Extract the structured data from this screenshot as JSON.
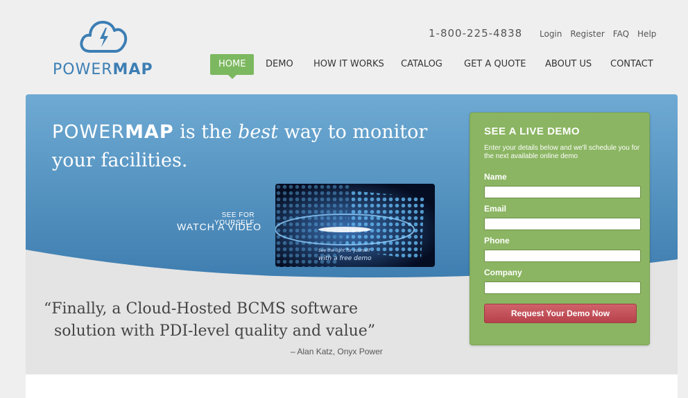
{
  "brand": {
    "logo_prefix": "POWER",
    "logo_suffix": "MAP"
  },
  "header": {
    "phone": "1-800-225-4838",
    "util_links": [
      "Login",
      "Register",
      "FAQ",
      "Help"
    ]
  },
  "nav": {
    "items": [
      "HOME",
      "DEMO",
      "HOW IT WORKS",
      "CATALOG",
      "GET A QUOTE",
      "ABOUT US",
      "CONTACT"
    ],
    "active": "HOME"
  },
  "hero": {
    "title_brand_prefix": "POWER",
    "title_brand_suffix": "MAP",
    "title_part1": " is the ",
    "title_emphasis": "best",
    "title_part2": " way to monitor your facilities.",
    "see_label": "SEE FOR YOURSELF",
    "watch_label": "WATCH A VIDEO",
    "video_caption_1": "See the light for yourself",
    "video_caption_2": "with a free demo"
  },
  "testimonial": {
    "line1": "“Finally, a Cloud-Hosted BCMS software",
    "line2": "solution with PDI-level quality and value”",
    "attribution": "– Alan Katz, Onyx Power"
  },
  "demo_form": {
    "title": "SEE A LIVE DEMO",
    "subtitle": "Enter your details below and we'll schedule you for the next available online demo",
    "fields": [
      "Name",
      "Email",
      "Phone",
      "Company"
    ],
    "submit_label": "Request Your Demo Now"
  },
  "colors": {
    "accent_green": "#7cb85f",
    "hero_blue": "#5a9cc8",
    "logo_blue": "#3c7eb4",
    "button_red": "#c04f58"
  }
}
